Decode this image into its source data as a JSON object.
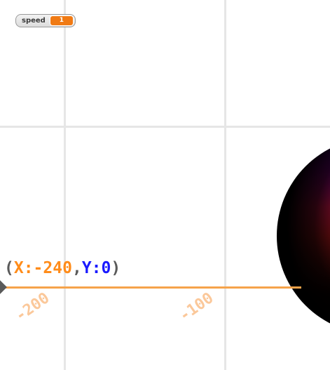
{
  "monitor": {
    "label": "speed",
    "value": "1",
    "value_color": "#f07a14"
  },
  "coordinate_readout": {
    "open_paren": "(",
    "x_text": "X:-240",
    "comma": ",",
    "y_text": "Y:0",
    "close_paren": ")",
    "x_color": "#ff8c1a",
    "y_color": "#1a1aff"
  },
  "axis": {
    "color": "#f6a34a",
    "tick_labels": [
      "-200",
      "-100"
    ],
    "tick_label_color": "#fbc89a"
  },
  "grid": {
    "color": "#e6e6e6"
  },
  "sprite": {
    "icon": "gradient-sphere",
    "colors": [
      "#9400ff",
      "#ff1a5a",
      "#d01a20",
      "#000000"
    ]
  }
}
